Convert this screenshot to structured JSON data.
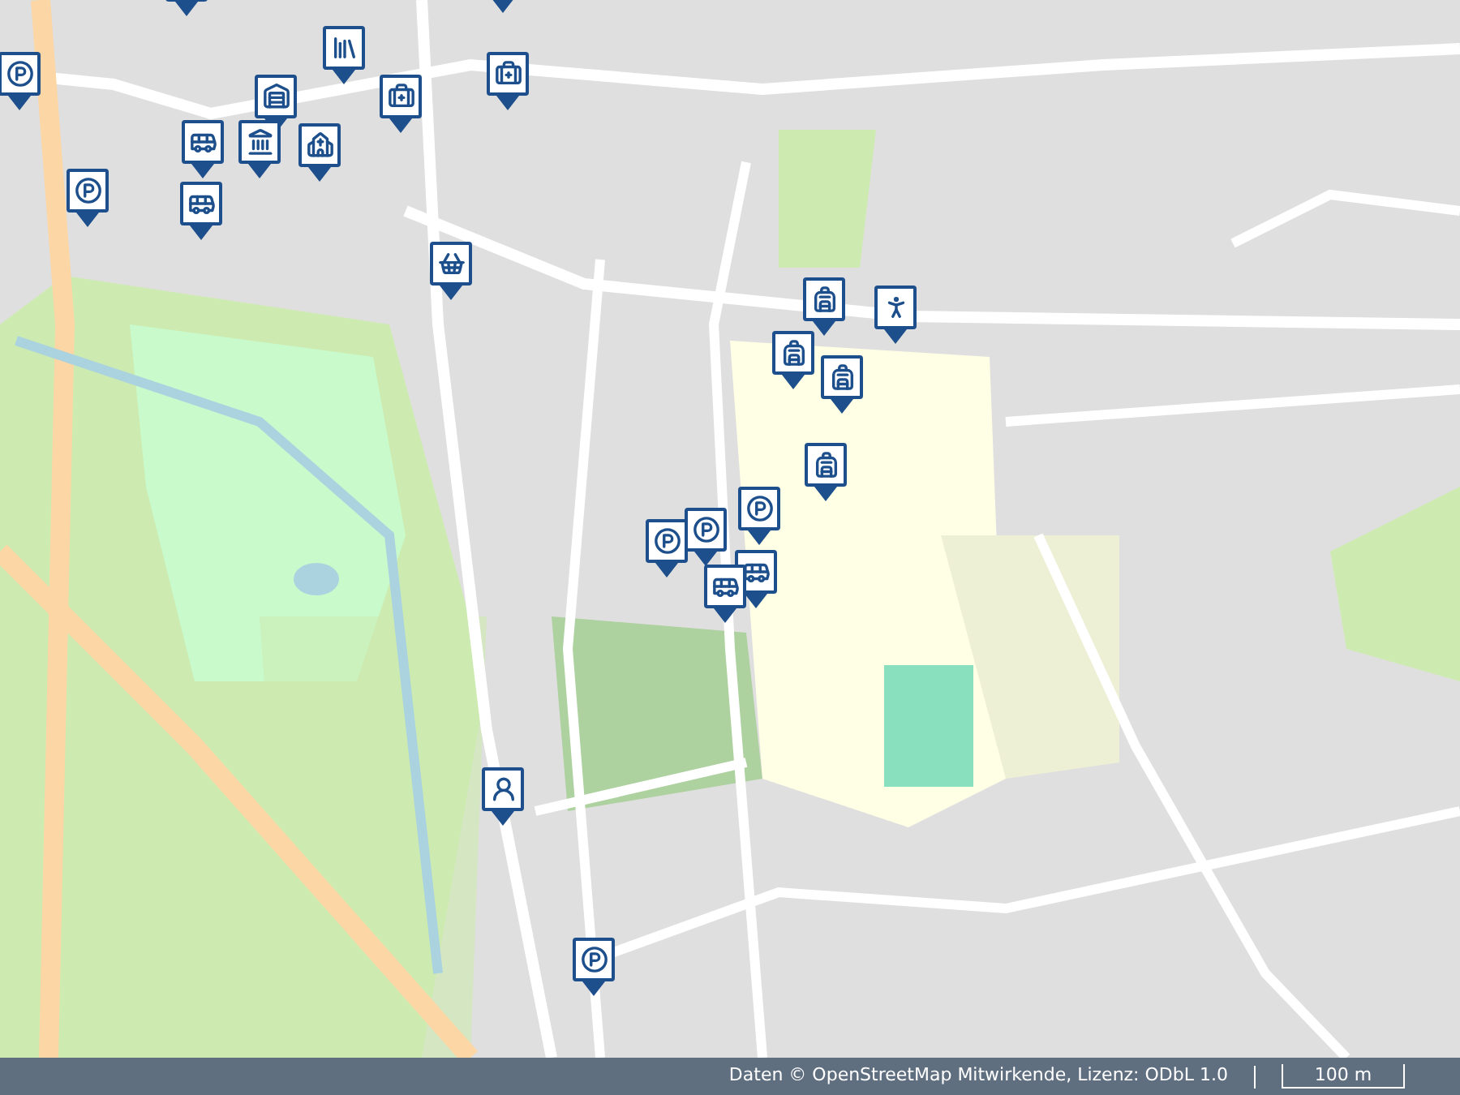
{
  "map": {
    "attribution": "Daten © OpenStreetMap Mitwirkende, Lizenz: ODbL 1.0",
    "scale": "100 m"
  }
}
